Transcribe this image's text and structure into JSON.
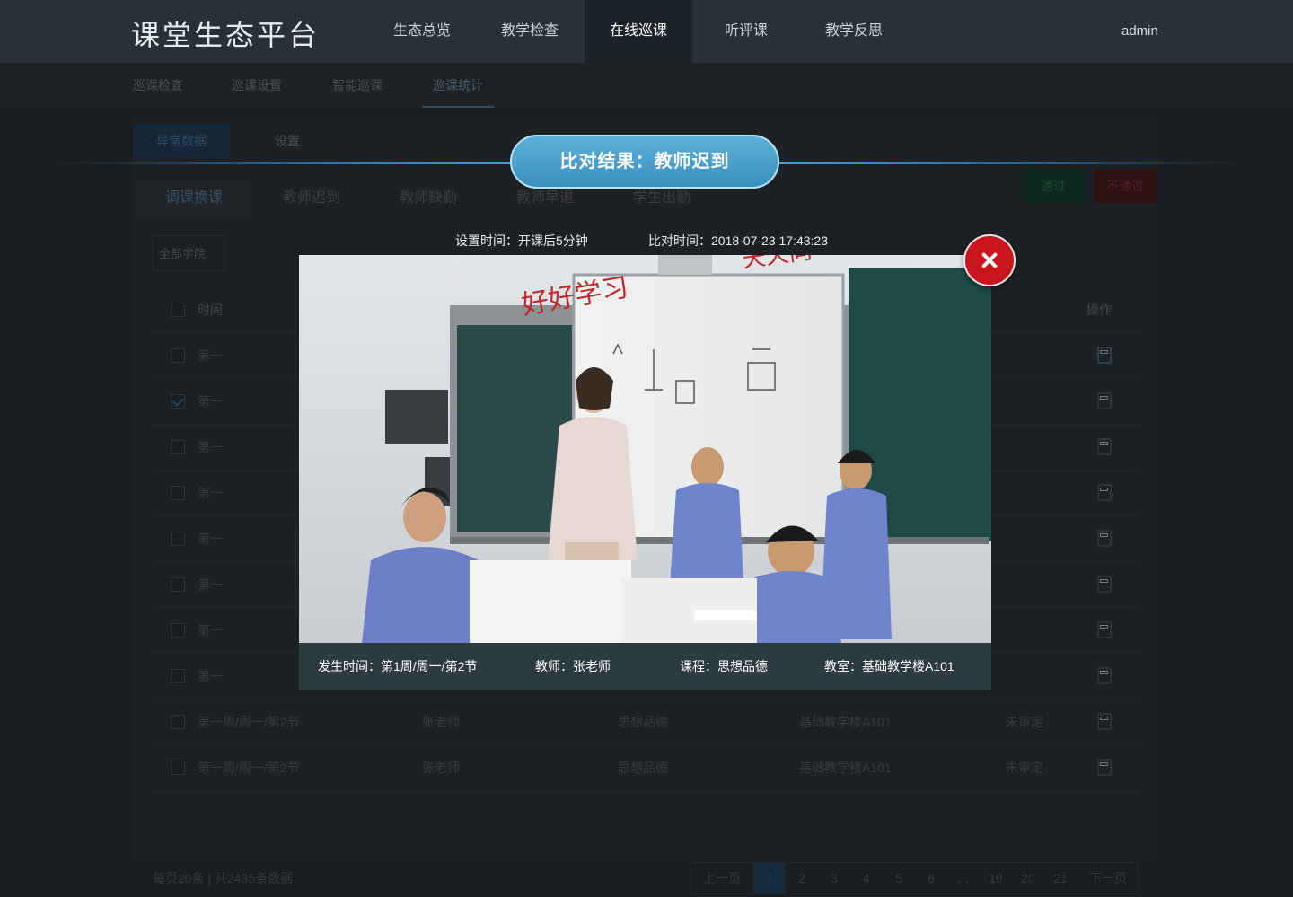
{
  "header": {
    "logo": "课堂生态平台",
    "nav": [
      "生态总览",
      "教学检查",
      "在线巡课",
      "听评课",
      "教学反思"
    ],
    "active_nav": "在线巡课",
    "user": "admin"
  },
  "subnav": {
    "items": [
      "巡课检查",
      "巡课设置",
      "智能巡课",
      "巡课统计"
    ],
    "active": "巡课统计"
  },
  "toolbar": {
    "tab_primary": "异常数据",
    "tab_plain": "设置",
    "pass_label": "通过",
    "fail_label": "不通过"
  },
  "subtabs": [
    "调课换课",
    "教师迟到",
    "教师缺勤",
    "教师早退",
    "学生出勤"
  ],
  "filter": {
    "college": "全部学院"
  },
  "table": {
    "headers": {
      "time": "时间",
      "op": "操作"
    },
    "rows": [
      {
        "time": "第一",
        "teacher": "",
        "course": "",
        "room": "",
        "status": "",
        "checked": false
      },
      {
        "time": "第一",
        "teacher": "",
        "course": "",
        "room": "",
        "status": "",
        "checked": true
      },
      {
        "time": "第一",
        "teacher": "",
        "course": "",
        "room": "",
        "status": "",
        "checked": false
      },
      {
        "time": "第一",
        "teacher": "",
        "course": "",
        "room": "",
        "status": "",
        "checked": false
      },
      {
        "time": "第一",
        "teacher": "",
        "course": "",
        "room": "",
        "status": "",
        "checked": false
      },
      {
        "time": "第一",
        "teacher": "",
        "course": "",
        "room": "",
        "status": "",
        "checked": false
      },
      {
        "time": "第一",
        "teacher": "",
        "course": "",
        "room": "",
        "status": "",
        "checked": false
      },
      {
        "time": "第一",
        "teacher": "",
        "course": "",
        "room": "",
        "status": "",
        "checked": false
      },
      {
        "time": "第一周/周一/第2节",
        "teacher": "张老师",
        "course": "思想品德",
        "room": "基础教学楼A101",
        "status": "未审定",
        "checked": false
      },
      {
        "time": "第一周/周一/第2节",
        "teacher": "张老师",
        "course": "思想品德",
        "room": "基础教学楼A101",
        "status": "未审定",
        "checked": false
      }
    ]
  },
  "footer": {
    "info": "每页20条 | 共2435条数据",
    "pager": {
      "prev": "上一页",
      "pages": [
        "1",
        "2",
        "3",
        "4",
        "5",
        "6",
        "...",
        "19",
        "20",
        "21"
      ],
      "active": "1",
      "next": "下一页"
    }
  },
  "modal": {
    "title": "比对结果：教师迟到",
    "set_time": "设置时间：开课后5分钟",
    "compare_time": "比对时间：2018-07-23 17:43:23",
    "photo_text": "好好学习",
    "photo_text_top": "天天向",
    "info": {
      "occur": "发生时间：第1周/周一/第2节",
      "teacher": "教师：张老师",
      "course": "课程：思想品德",
      "room": "教室：基础教学楼A101"
    },
    "colors": {
      "pill": "#4ba0cd",
      "close": "#c8141a",
      "glow": "#6fc2f5"
    }
  }
}
